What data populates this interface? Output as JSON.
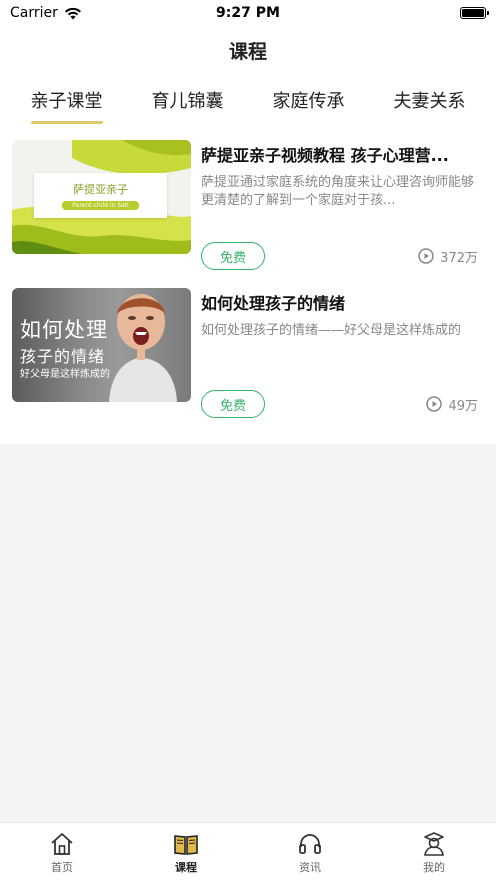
{
  "status": {
    "carrier": "Carrier",
    "time": "9:27 PM"
  },
  "nav": {
    "title": "课程"
  },
  "tabs": [
    {
      "label": "亲子课堂",
      "active": true
    },
    {
      "label": "育儿锦囊",
      "active": false
    },
    {
      "label": "家庭传承",
      "active": false
    },
    {
      "label": "夫妻关系",
      "active": false
    }
  ],
  "courses": [
    {
      "title": "萨提亚亲子视频教程 孩子心理营...",
      "description": "萨提亚通过家庭系统的角度来让心理咨询师能够更清楚的了解到一个家庭对于孩...",
      "badge": "免费",
      "views": "372万",
      "thumb_title": "萨提亚亲子",
      "thumb_subtitle": "Parent-child in Sati"
    },
    {
      "title": "如何处理孩子的情绪",
      "description": "如何处理孩子的情绪——好父母是这样炼成的",
      "badge": "免费",
      "views": "49万",
      "thumb_line1": "如何处理",
      "thumb_line2": "孩子的情绪",
      "thumb_line3": "好父母是这样炼成的"
    }
  ],
  "tabbar": [
    {
      "label": "首页",
      "icon": "home-icon",
      "active": false
    },
    {
      "label": "课程",
      "icon": "book-icon",
      "active": true
    },
    {
      "label": "资讯",
      "icon": "headphones-icon",
      "active": false
    },
    {
      "label": "我的",
      "icon": "graduate-icon",
      "active": false
    }
  ],
  "colors": {
    "accent_green": "#36b36e",
    "tab_underline": "#e0c96a"
  }
}
